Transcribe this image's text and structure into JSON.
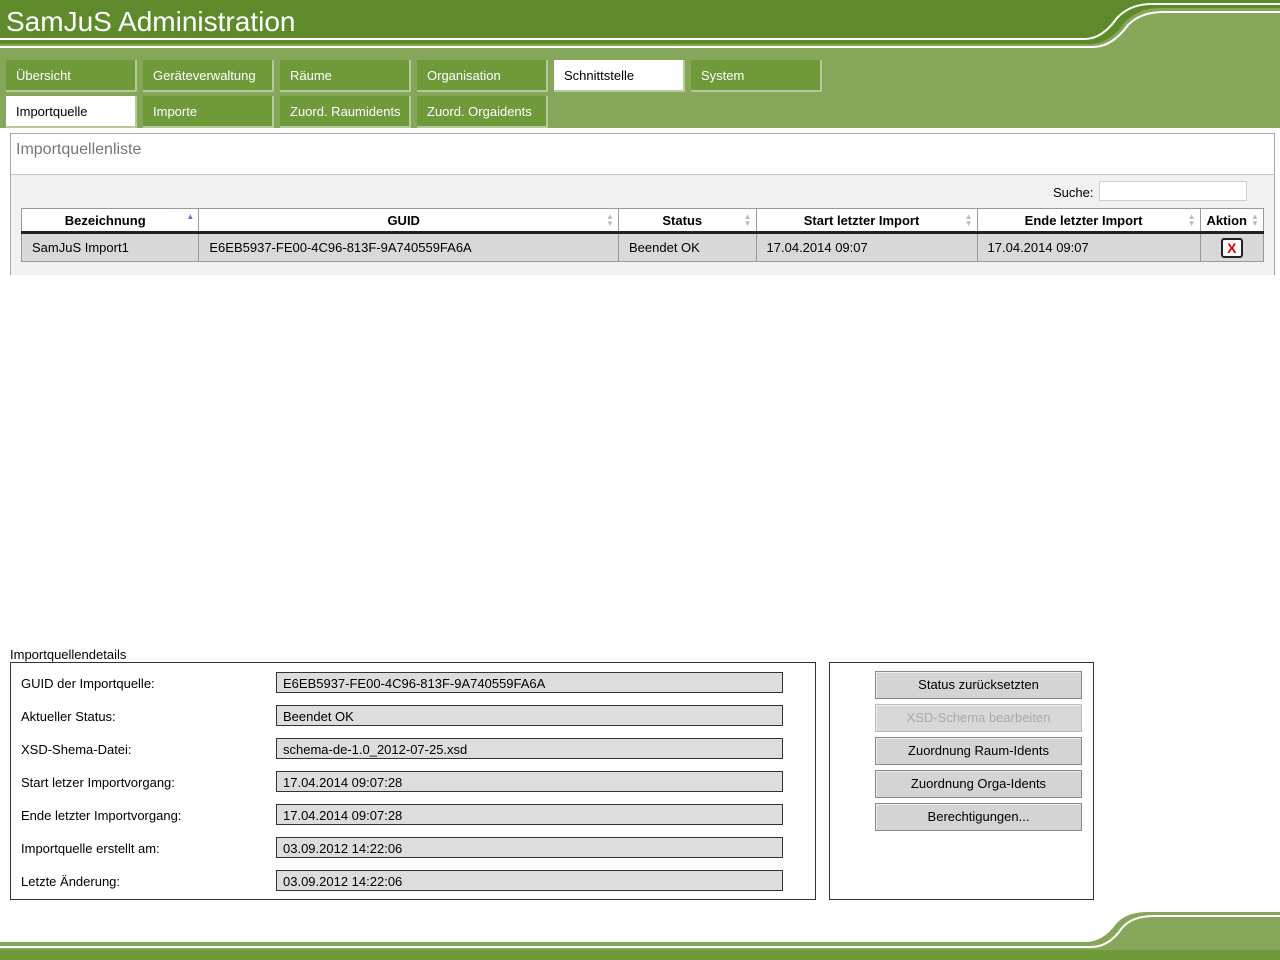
{
  "app": {
    "title": "SamJuS Administration"
  },
  "nav": {
    "main_tabs": [
      {
        "label": "Übersicht"
      },
      {
        "label": "Geräteverwaltung"
      },
      {
        "label": "Räume"
      },
      {
        "label": "Organisation"
      },
      {
        "label": "Schnittstelle",
        "active": true
      },
      {
        "label": "System"
      }
    ],
    "sub_tabs": [
      {
        "label": "Importquelle",
        "active": true
      },
      {
        "label": "Importe"
      },
      {
        "label": "Zuord. Raumidents"
      },
      {
        "label": "Zuord. Orgaidents"
      }
    ]
  },
  "list": {
    "title": "Importquellenliste",
    "search_label": "Suche:",
    "search_value": "",
    "columns": [
      "Bezeichnung",
      "GUID",
      "Status",
      "Start letzter Import",
      "Ende letzter Import",
      "Aktion"
    ],
    "rows": [
      {
        "name": "SamJuS Import1",
        "guid": "E6EB5937-FE00-4C96-813F-9A740559FA6A",
        "status": "Beendet OK",
        "start": "17.04.2014 09:07",
        "end": "17.04.2014 09:07",
        "action_icon": "delete-icon"
      }
    ]
  },
  "details": {
    "legend": "Importquellendetails",
    "fields": [
      {
        "label": "GUID der Importquelle:",
        "value": "E6EB5937-FE00-4C96-813F-9A740559FA6A"
      },
      {
        "label": "Aktueller Status:",
        "value": "Beendet OK"
      },
      {
        "label": "XSD-Shema-Datei:",
        "value": "schema-de-1.0_2012-07-25.xsd"
      },
      {
        "label": "Start letzer Importvorgang:",
        "value": "17.04.2014 09:07:28"
      },
      {
        "label": "Ende letzter Importvorgang:",
        "value": "17.04.2014 09:07:28"
      },
      {
        "label": "Importquelle erstellt am:",
        "value": "03.09.2012 14:22:06"
      },
      {
        "label": "Letzte Änderung:",
        "value": "03.09.2012 14:22:06"
      }
    ]
  },
  "actions": {
    "buttons": [
      {
        "label": "Status zurücksetzten",
        "enabled": true
      },
      {
        "label": "XSD-Schema bearbeiten",
        "enabled": false
      },
      {
        "label": "Zuordnung Raum-Idents",
        "enabled": true
      },
      {
        "label": "Zuordnung Orga-Idents",
        "enabled": true
      },
      {
        "label": "Berechtigungen...",
        "enabled": true
      }
    ]
  },
  "colors": {
    "header_dark": "#5e8a2b",
    "header_light": "#86a75a",
    "tab_green": "#6f9a3a"
  }
}
